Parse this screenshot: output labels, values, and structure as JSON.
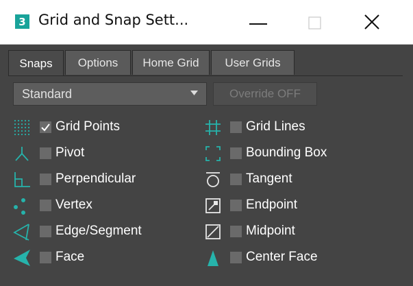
{
  "window": {
    "app_icon_glyph": "3",
    "title": "Grid and Snap Sett...",
    "buttons": [
      "minimize",
      "maximize",
      "close"
    ]
  },
  "tabs": [
    {
      "label": "Snaps",
      "active": true
    },
    {
      "label": "Options",
      "active": false
    },
    {
      "label": "Home Grid",
      "active": false
    },
    {
      "label": "User Grids",
      "active": false
    }
  ],
  "snaps": {
    "preset": "Standard",
    "override_label": "Override OFF",
    "left": [
      {
        "label": "Grid Points",
        "checked": true,
        "icon": "grid-points-icon"
      },
      {
        "label": "Pivot",
        "checked": false,
        "icon": "pivot-icon"
      },
      {
        "label": "Perpendicular",
        "checked": false,
        "icon": "perpendicular-icon"
      },
      {
        "label": "Vertex",
        "checked": false,
        "icon": "vertex-icon"
      },
      {
        "label": "Edge/Segment",
        "checked": false,
        "icon": "edge-segment-icon"
      },
      {
        "label": "Face",
        "checked": false,
        "icon": "face-icon"
      }
    ],
    "right": [
      {
        "label": "Grid Lines",
        "checked": false,
        "icon": "grid-lines-icon"
      },
      {
        "label": "Bounding Box",
        "checked": false,
        "icon": "bounding-box-icon"
      },
      {
        "label": "Tangent",
        "checked": false,
        "icon": "tangent-icon"
      },
      {
        "label": "Endpoint",
        "checked": false,
        "icon": "endpoint-icon"
      },
      {
        "label": "Midpoint",
        "checked": false,
        "icon": "midpoint-icon"
      },
      {
        "label": "Center Face",
        "checked": false,
        "icon": "center-face-icon"
      }
    ]
  },
  "colors": {
    "accent": "#26b3ab",
    "panel": "#444444",
    "text": "#ffffff"
  }
}
